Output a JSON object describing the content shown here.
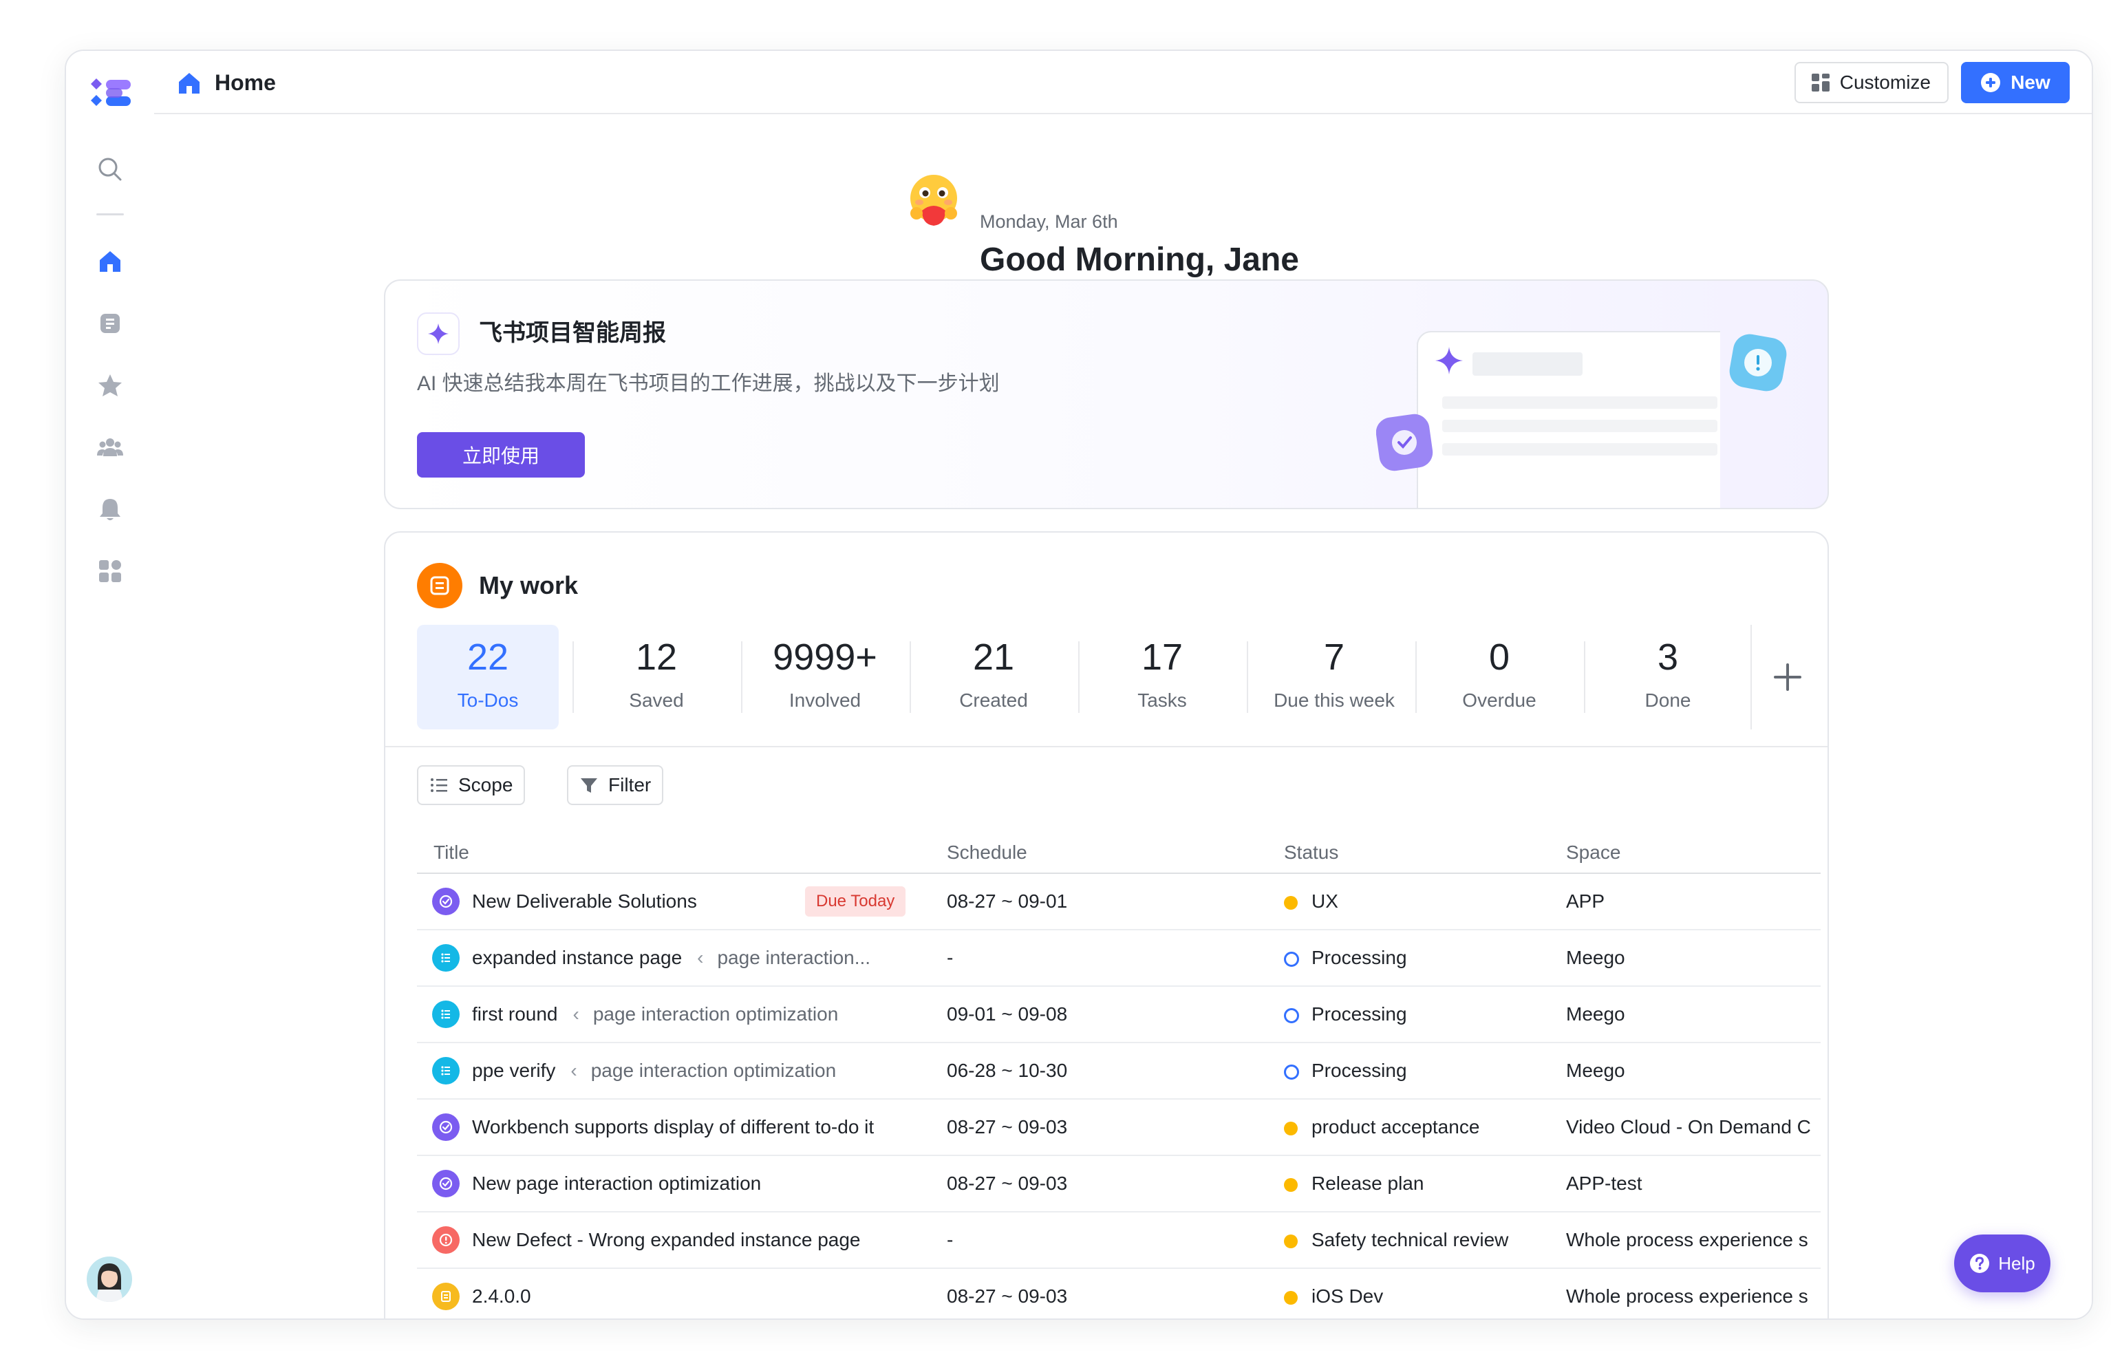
{
  "app": {
    "logo_icon": "app-logo-icon",
    "brand_color": "#6a4ee6",
    "accent_color": "#3370ff"
  },
  "sidebar": {
    "items": [
      {
        "name": "search",
        "icon": "search-icon",
        "active": false
      },
      {
        "name": "home",
        "icon": "home-icon",
        "active": true
      },
      {
        "name": "docs",
        "icon": "doc-icon",
        "active": false
      },
      {
        "name": "favorites",
        "icon": "star-icon",
        "active": false
      },
      {
        "name": "team",
        "icon": "people-icon",
        "active": false
      },
      {
        "name": "notifications",
        "icon": "bell-icon",
        "active": false
      },
      {
        "name": "apps",
        "icon": "apps-grid-icon",
        "active": false
      }
    ],
    "avatar_icon": "user-avatar"
  },
  "topbar": {
    "title": "Home",
    "customize_label": "Customize",
    "new_label": "New"
  },
  "greeting": {
    "date": "Monday, Mar 6th",
    "message": "Good Morning, Jane",
    "emoji_icon": "hugging-face-emoji"
  },
  "ai_card": {
    "title": "飞书项目智能周报",
    "subtitle": "AI 快速总结我本周在飞书项目的工作进展，挑战以及下一步计划",
    "button_label": "立即使用",
    "icon": "sparkle-icon"
  },
  "my_work": {
    "title": "My work",
    "stats": [
      {
        "value": "22",
        "label": "To-Dos",
        "active": true
      },
      {
        "value": "12",
        "label": "Saved",
        "active": false
      },
      {
        "value": "9999+",
        "label": "Involved",
        "active": false
      },
      {
        "value": "21",
        "label": "Created",
        "active": false
      },
      {
        "value": "17",
        "label": "Tasks",
        "active": false
      },
      {
        "value": "7",
        "label": "Due this week",
        "active": false
      },
      {
        "value": "0",
        "label": "Overdue",
        "active": false
      },
      {
        "value": "3",
        "label": "Done",
        "active": false
      }
    ],
    "scope_label": "Scope",
    "filter_label": "Filter",
    "columns": {
      "title": "Title",
      "schedule": "Schedule",
      "status": "Status",
      "space": "Space"
    },
    "rows": [
      {
        "type": "story",
        "title": "New Deliverable Solutions",
        "parent": "",
        "badge": "Due Today",
        "schedule": "08-27 ~ 09-01",
        "status": "UX",
        "status_style": "dot-yellow",
        "space": "APP"
      },
      {
        "type": "task",
        "title": "expanded instance page",
        "parent": "page interaction...",
        "badge": "",
        "schedule": "-",
        "status": "Processing",
        "status_style": "ring-blue",
        "space": "Meego"
      },
      {
        "type": "task",
        "title": "first round",
        "parent": "page interaction optimization",
        "badge": "",
        "schedule": "09-01 ~ 09-08",
        "status": "Processing",
        "status_style": "ring-blue",
        "space": "Meego"
      },
      {
        "type": "task",
        "title": "ppe verify",
        "parent": "page interaction optimization",
        "badge": "",
        "schedule": "06-28 ~ 10-30",
        "status": "Processing",
        "status_style": "ring-blue",
        "space": "Meego"
      },
      {
        "type": "story",
        "title": "Workbench supports display of different to-do it",
        "parent": "",
        "badge": "",
        "schedule": "08-27 ~ 09-03",
        "status": "product acceptance",
        "status_style": "dot-yellow",
        "space": "Video Cloud - On Demand C"
      },
      {
        "type": "story",
        "title": "New page interaction optimization",
        "parent": "",
        "badge": "",
        "schedule": "08-27 ~ 09-03",
        "status": "Release plan",
        "status_style": "dot-yellow",
        "space": "APP-test"
      },
      {
        "type": "defect",
        "title": "New Defect - Wrong expanded instance page",
        "parent": "",
        "badge": "",
        "schedule": "-",
        "status": "Safety technical review",
        "status_style": "dot-yellow",
        "space": "Whole process experience s"
      },
      {
        "type": "version",
        "title": "2.4.0.0",
        "parent": "",
        "badge": "",
        "schedule": "08-27 ~ 09-03",
        "status": "iOS Dev",
        "status_style": "dot-yellow",
        "space": "Whole process experience s"
      }
    ],
    "type_colors": {
      "story": "#7b5cf0",
      "task": "#14b8e6",
      "defect": "#f76964",
      "version": "#f7ba1e"
    }
  },
  "help": {
    "label": "Help"
  }
}
